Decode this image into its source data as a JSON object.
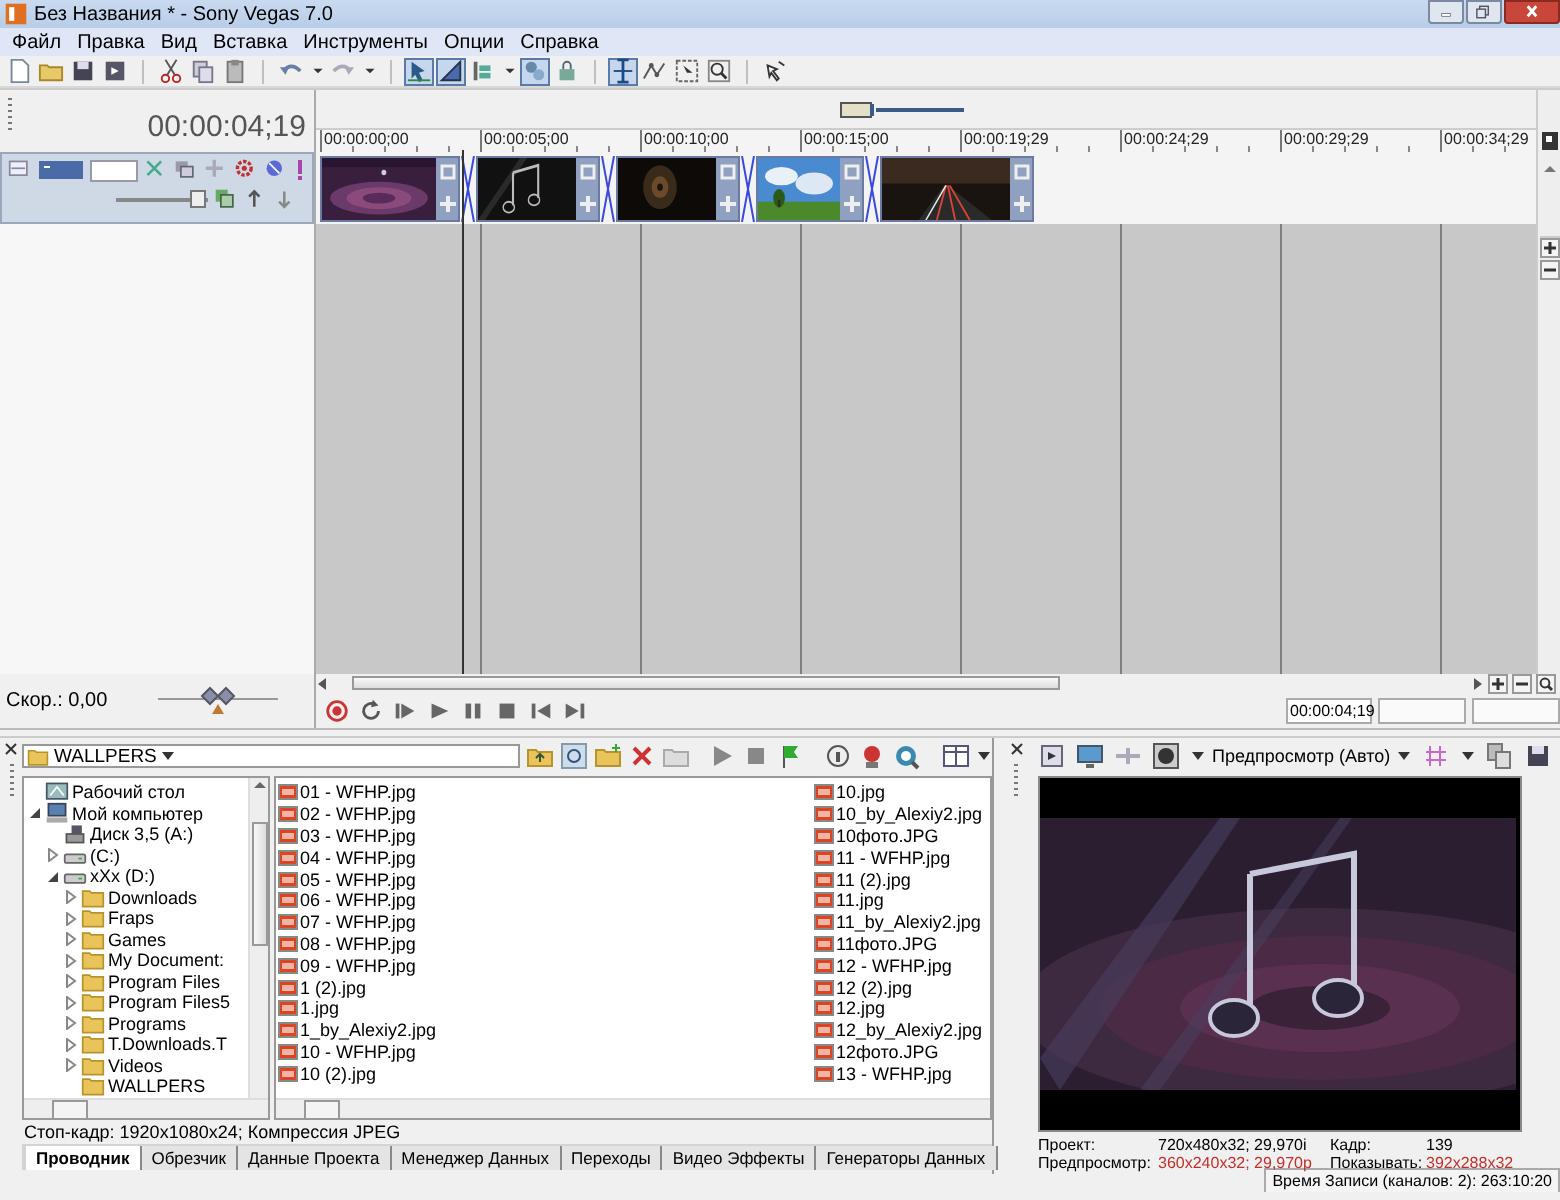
{
  "window": {
    "title": "Без Названия * - Sony Vegas 7.0"
  },
  "menu": [
    "Файл",
    "Правка",
    "Вид",
    "Вставка",
    "Инструменты",
    "Опции",
    "Справка"
  ],
  "toolbar": [
    {
      "kind": "new",
      "on": false
    },
    {
      "kind": "open",
      "on": false
    },
    {
      "kind": "save",
      "on": false
    },
    {
      "kind": "render",
      "on": false
    },
    {
      "kind": "sep"
    },
    {
      "kind": "cut",
      "on": false
    },
    {
      "kind": "copy",
      "on": false
    },
    {
      "kind": "paste",
      "on": false
    },
    {
      "kind": "sep"
    },
    {
      "kind": "undo",
      "on": false
    },
    {
      "kind": "caret",
      "on": false
    },
    {
      "kind": "redo",
      "on": false
    },
    {
      "kind": "caret",
      "on": false
    },
    {
      "kind": "sep"
    },
    {
      "kind": "snap",
      "on": true
    },
    {
      "kind": "ripple",
      "on": true
    },
    {
      "kind": "bars",
      "on": false
    },
    {
      "kind": "caret",
      "on": false
    },
    {
      "kind": "group",
      "on": true
    },
    {
      "kind": "lock",
      "on": false
    },
    {
      "kind": "sep"
    },
    {
      "kind": "edit",
      "on": true
    },
    {
      "kind": "envelope",
      "on": false
    },
    {
      "kind": "select",
      "on": false
    },
    {
      "kind": "zoom",
      "on": false
    },
    {
      "kind": "sep"
    },
    {
      "kind": "pointer",
      "on": false
    }
  ],
  "timeline": {
    "time": "00:00:04;19",
    "ruler": [
      "00:00:00;00",
      "00:00:05;00",
      "00:00:10;00",
      "00:00:15;00",
      "00:00:19;29",
      "00:00:24;29",
      "00:00:29;29",
      "00:00:34;29"
    ],
    "track": {
      "level": 0.9
    },
    "rate": {
      "label": "Скор.: 0,00",
      "level": 0.5
    }
  },
  "transport": {
    "buttons": [
      {
        "kind": "record"
      },
      {
        "kind": "loop"
      },
      {
        "kind": "play-start"
      },
      {
        "kind": "play"
      },
      {
        "kind": "pause"
      },
      {
        "kind": "stop"
      },
      {
        "kind": "prev"
      },
      {
        "kind": "next"
      }
    ],
    "time": "00:00:04;19"
  },
  "explorer": {
    "path": "WALLPERS",
    "tree": [
      {
        "label": "Рабочий стол",
        "kind": "desktop"
      },
      {
        "label": "Мой компьютер",
        "kind": "computer",
        "expanded": true,
        "children": [
          {
            "label": "Диск 3,5 (A:)",
            "kind": "floppy"
          },
          {
            "label": "(C:)",
            "kind": "drive",
            "expanded": false
          },
          {
            "label": "xXx (D:)",
            "kind": "drive",
            "expanded": true,
            "children": [
              {
                "label": "Downloads",
                "kind": "folder",
                "expanded": false
              },
              {
                "label": "Fraps",
                "kind": "folder",
                "expanded": false
              },
              {
                "label": "Games",
                "kind": "folder",
                "expanded": false
              },
              {
                "label": "My Document:",
                "kind": "folder",
                "expanded": false
              },
              {
                "label": "Program Files",
                "kind": "folder",
                "expanded": false
              },
              {
                "label": "Program Files5",
                "kind": "folder",
                "expanded": false
              },
              {
                "label": "Programs",
                "kind": "folder",
                "expanded": false
              },
              {
                "label": "T.Downloads.T",
                "kind": "folder",
                "expanded": false
              },
              {
                "label": "Videos",
                "kind": "folder",
                "expanded": false
              },
              {
                "label": "WALLPERS",
                "kind": "folder"
              }
            ]
          }
        ]
      }
    ],
    "files": [
      "01 - WFHP.jpg",
      "02 - WFHP.jpg",
      "03 - WFHP.jpg",
      "04 - WFHP.jpg",
      "05 - WFHP.jpg",
      "06 - WFHP.jpg",
      "07 - WFHP.jpg",
      "08 - WFHP.jpg",
      "09 - WFHP.jpg",
      "1 (2).jpg",
      "1.jpg",
      "1_by_Alexiy2.jpg",
      "10 - WFHP.jpg",
      "10 (2).jpg",
      "10.jpg",
      "10_by_Alexiy2.jpg",
      "10фото.JPG",
      "11 - WFHP.jpg",
      "11 (2).jpg",
      "11.jpg",
      "11_by_Alexiy2.jpg",
      "11фото.JPG",
      "12 - WFHP.jpg",
      "12 (2).jpg",
      "12.jpg",
      "12_by_Alexiy2.jpg",
      "12фото.JPG",
      "13 - WFHP.jpg"
    ],
    "status": "Стоп-кадр: 1920x1080x24; Компрессия JPEG",
    "tabs": [
      {
        "label": "Проводник",
        "selected": true
      },
      {
        "label": "Обрезчик",
        "selected": false
      },
      {
        "label": "Данные Проекта",
        "selected": false
      },
      {
        "label": "Менеджер Данных",
        "selected": false
      },
      {
        "label": "Переходы",
        "selected": false
      },
      {
        "label": "Видео Эффекты",
        "selected": false
      },
      {
        "label": "Генераторы Данных",
        "selected": false
      }
    ]
  },
  "preview": {
    "mode": "Предпросмотр (Авто)",
    "info": [
      {
        "label": "Проект:",
        "value": "720x480x32; 29,970i",
        "highlighted": false
      },
      {
        "label": "Кадр:",
        "value": "139",
        "highlighted": false
      },
      {
        "label": "Предпросмотр:",
        "value": "360x240x32; 29,970p",
        "highlighted": true
      },
      {
        "label": "Показывать:",
        "value": "392x288x32",
        "highlighted": true
      }
    ]
  },
  "status_bar": {
    "text": "Время Записи (каналов: 2): 263:10:20"
  }
}
